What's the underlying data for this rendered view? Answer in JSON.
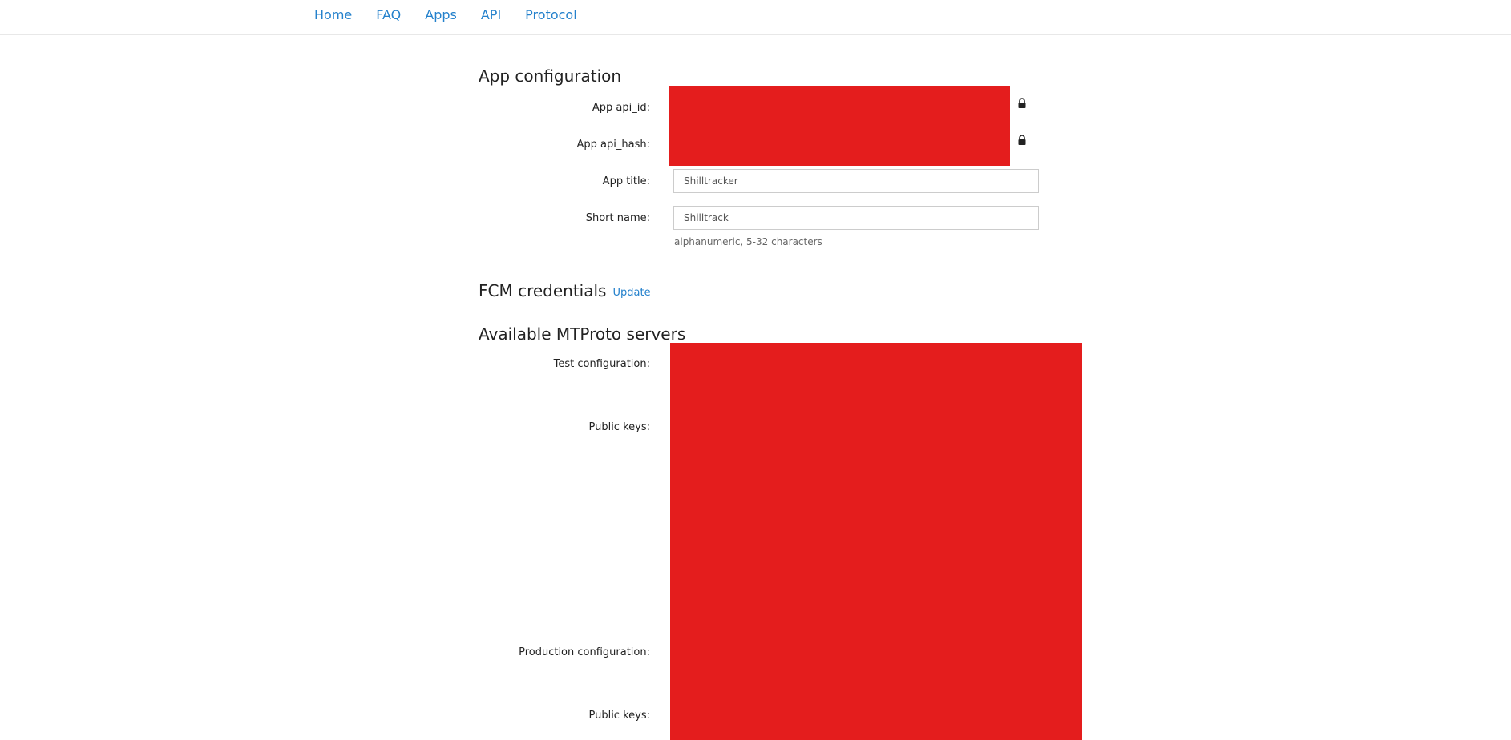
{
  "nav": {
    "items": [
      {
        "label": "Home"
      },
      {
        "label": "FAQ"
      },
      {
        "label": "Apps"
      },
      {
        "label": "API"
      },
      {
        "label": "Protocol"
      }
    ]
  },
  "app_config": {
    "title": "App configuration",
    "api_id_label": "App api_id:",
    "api_hash_label": "App api_hash:",
    "app_title_label": "App title:",
    "app_title_value": "Shilltracker",
    "short_name_label": "Short name:",
    "short_name_value": "Shilltrack",
    "short_name_hint": "alphanumeric, 5-32 characters"
  },
  "fcm": {
    "title": "FCM credentials",
    "update_label": "Update"
  },
  "mtproto": {
    "title": "Available MTProto servers",
    "test_config_label": "Test configuration:",
    "test_public_keys_label": "Public keys:",
    "prod_config_label": "Production configuration:",
    "prod_public_keys_label": "Public keys:"
  },
  "colors": {
    "link": "#2481cc",
    "redaction": "#e41d1d"
  },
  "icons": {
    "lock": "lock-icon"
  }
}
